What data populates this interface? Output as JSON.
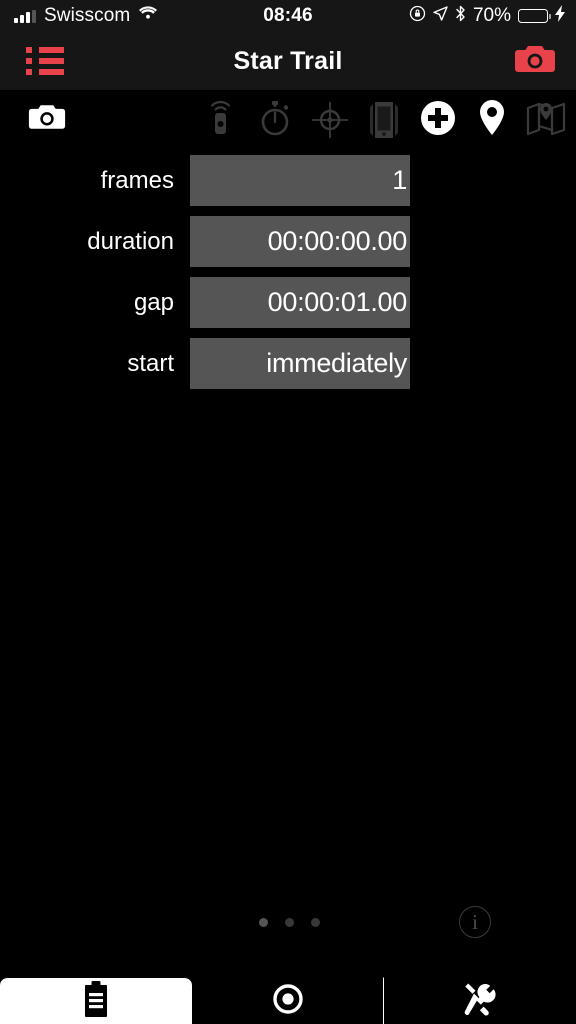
{
  "status_bar": {
    "carrier": "Swisscom",
    "wifi_icon": "wifi-icon",
    "time": "08:46",
    "rotation_lock_icon": "rotation-lock-icon",
    "location_icon": "location-arrow-icon",
    "bluetooth_icon": "bluetooth-icon",
    "battery_percent": "70%",
    "battery_fill_color": "#4CD964",
    "charging_icon": "lightning-bolt-icon"
  },
  "nav_bar": {
    "title": "Star Trail",
    "left_icon": "list-icon",
    "right_icon": "camera-icon",
    "accent_color": "#E8424A"
  },
  "toolbar": {
    "camera_icon": "camera-icon",
    "items": [
      {
        "name": "remote-trigger-icon",
        "state": "dim"
      },
      {
        "name": "stopwatch-icon",
        "state": "dim"
      },
      {
        "name": "crosshair-icon",
        "state": "dim"
      },
      {
        "name": "device-phone-icon",
        "state": "dim"
      },
      {
        "name": "plus-circle-icon",
        "state": "lit"
      },
      {
        "name": "location-pin-icon",
        "state": "lit"
      },
      {
        "name": "map-icon",
        "state": "dim"
      }
    ]
  },
  "form": {
    "fields": [
      {
        "label": "frames",
        "value": "1"
      },
      {
        "label": "duration",
        "value": "00:00:00.00"
      },
      {
        "label": "gap",
        "value": "00:00:01.00"
      },
      {
        "label": "start",
        "value": "immediately"
      }
    ]
  },
  "pager": {
    "dot_count": 3,
    "active_index": 0,
    "info_label": "i"
  },
  "tab_bar": {
    "tabs": [
      {
        "name": "tab-clipboard",
        "icon": "clipboard-icon",
        "active": true
      },
      {
        "name": "tab-shutter",
        "icon": "shutter-circle-icon",
        "active": false
      },
      {
        "name": "tab-tools",
        "icon": "tools-icon",
        "active": false
      }
    ]
  }
}
